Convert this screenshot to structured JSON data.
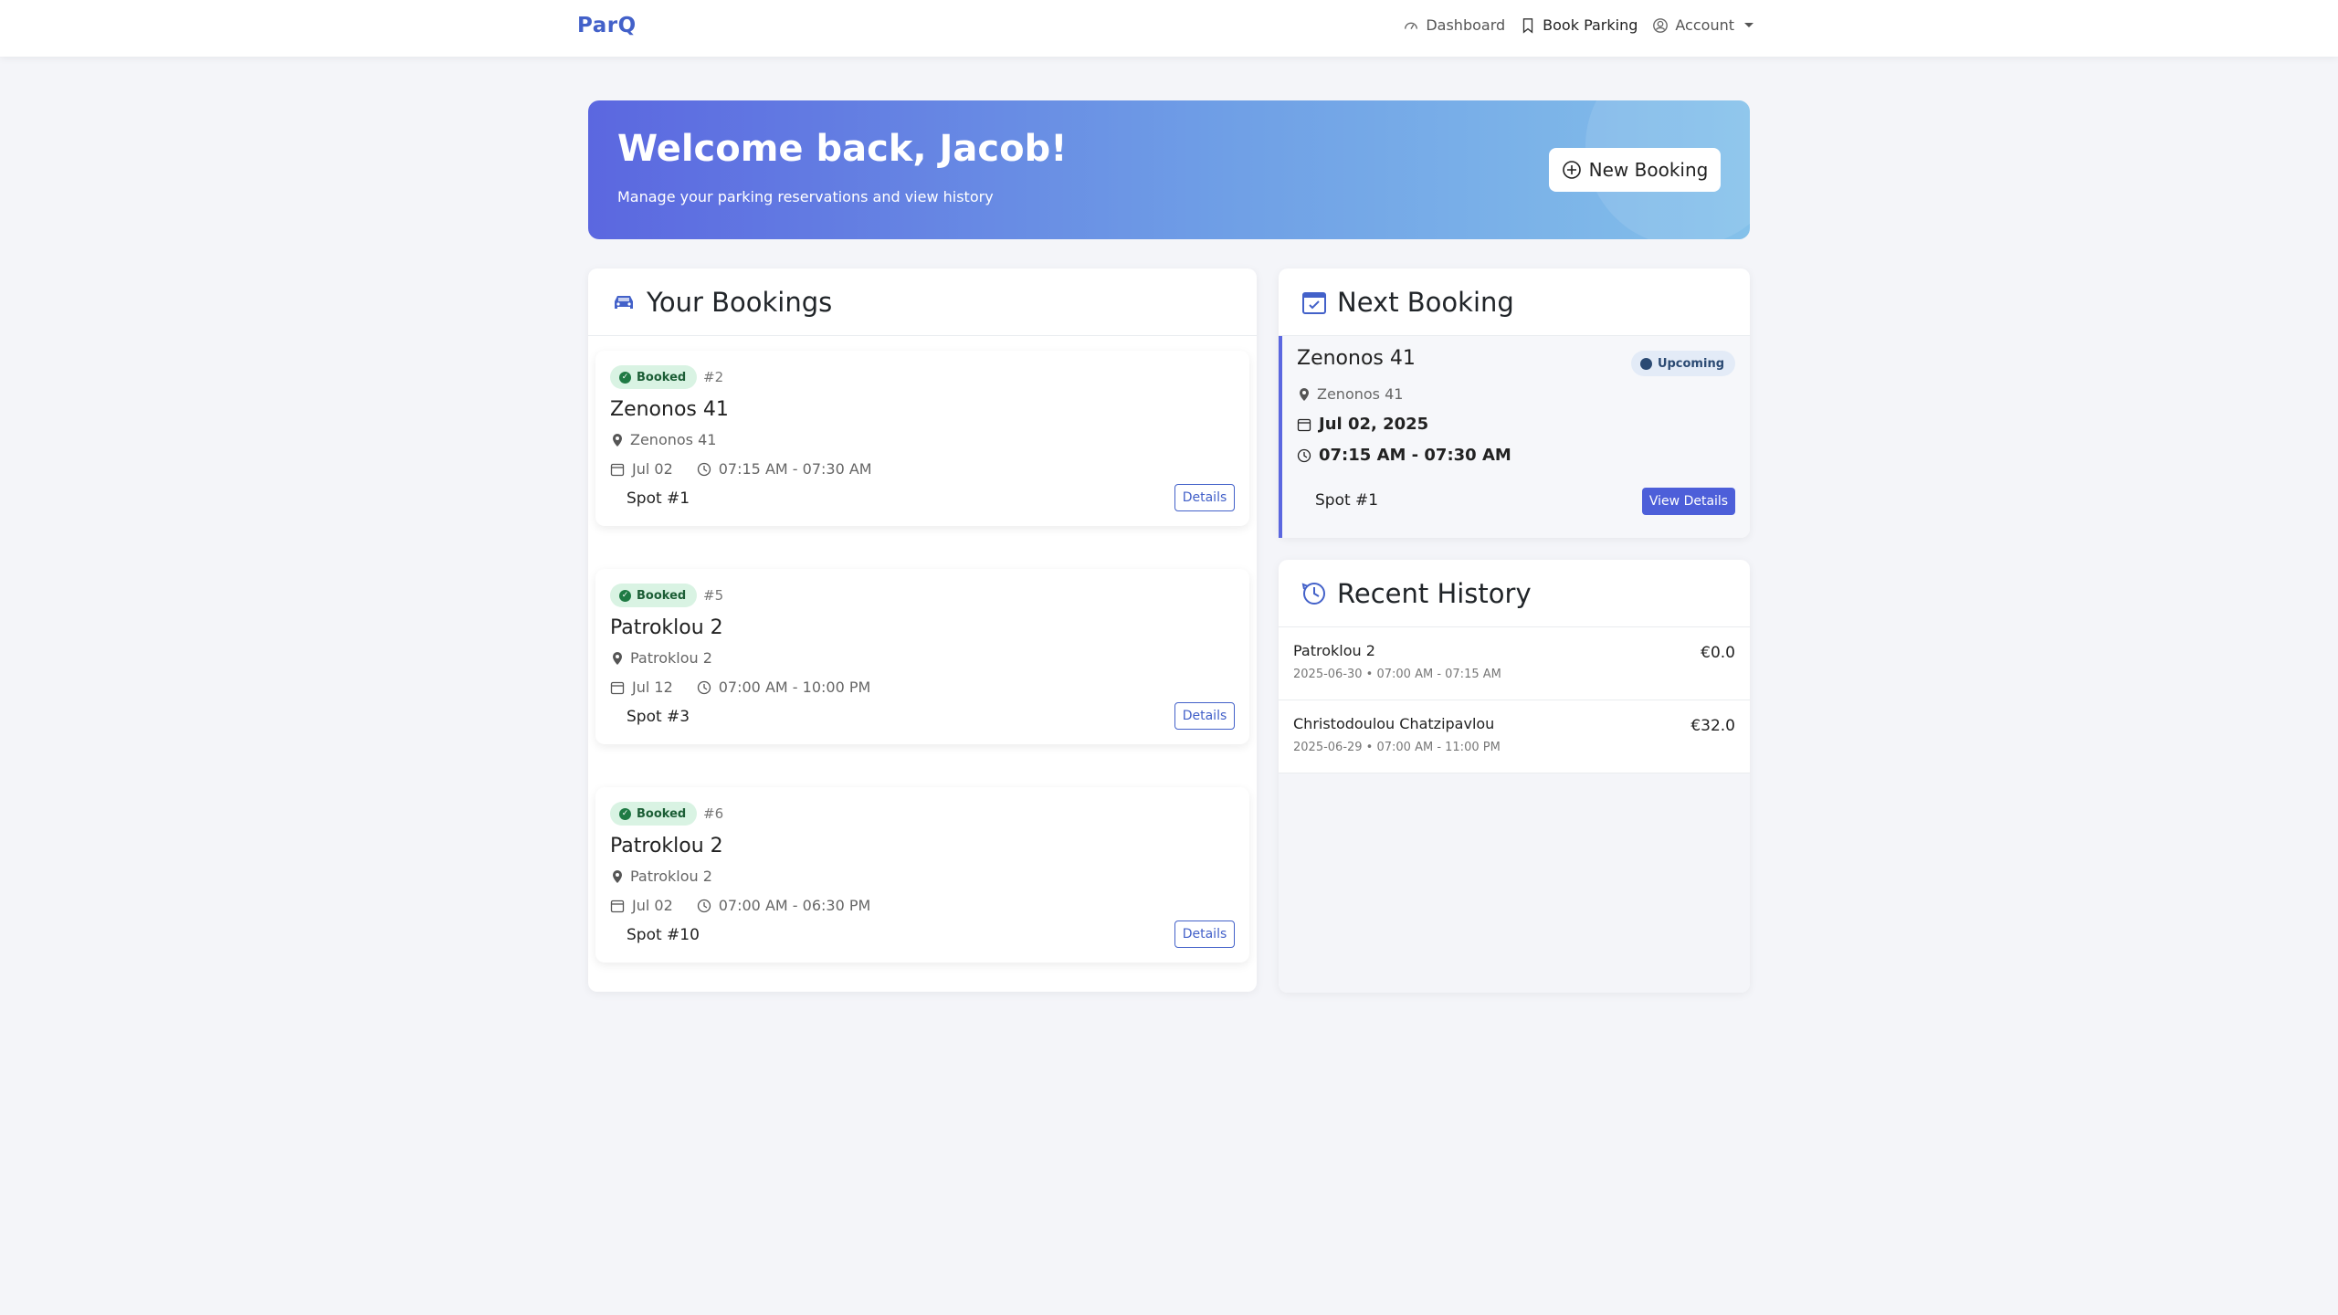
{
  "nav": {
    "brand": "ParQ",
    "dashboard": "Dashboard",
    "book_parking": "Book Parking",
    "account": "Account"
  },
  "hero": {
    "title": "Welcome back, Jacob!",
    "subtitle": "Manage your parking reservations and view history",
    "button": "New Booking"
  },
  "bookings": {
    "title": "Your Bookings",
    "items": [
      {
        "status": "Booked",
        "number": "#2",
        "name": "Zenonos 41",
        "location": "Zenonos 41",
        "date": "Jul 02",
        "time": "07:15 AM - 07:30 AM",
        "spot": "Spot #1",
        "action": "Details"
      },
      {
        "status": "Booked",
        "number": "#5",
        "name": "Patroklou 2",
        "location": "Patroklou 2",
        "date": "Jul 12",
        "time": "07:00 AM - 10:00 PM",
        "spot": "Spot #3",
        "action": "Details"
      },
      {
        "status": "Booked",
        "number": "#6",
        "name": "Patroklou 2",
        "location": "Patroklou 2",
        "date": "Jul 02",
        "time": "07:00 AM - 06:30 PM",
        "spot": "Spot #10",
        "action": "Details"
      }
    ]
  },
  "next": {
    "title": "Next Booking",
    "name": "Zenonos 41",
    "status": "Upcoming",
    "location": "Zenonos 41",
    "date": "Jul 02, 2025",
    "time": "07:15 AM - 07:30 AM",
    "spot": "Spot #1",
    "action": "View Details"
  },
  "history": {
    "title": "Recent History",
    "items": [
      {
        "name": "Patroklou 2",
        "meta": "2025-06-30 • 07:00 AM - 07:15 AM",
        "price": "€0.0"
      },
      {
        "name": "Christodoulou Chatzipavlou",
        "meta": "2025-06-29 • 07:00 AM - 11:00 PM",
        "price": "€32.0"
      }
    ]
  },
  "colors": {
    "brand": "#4361c9",
    "accent": "#5b67e0",
    "booked_bg": "#d9f3e3",
    "upcoming_bg": "#e3ebf7"
  }
}
